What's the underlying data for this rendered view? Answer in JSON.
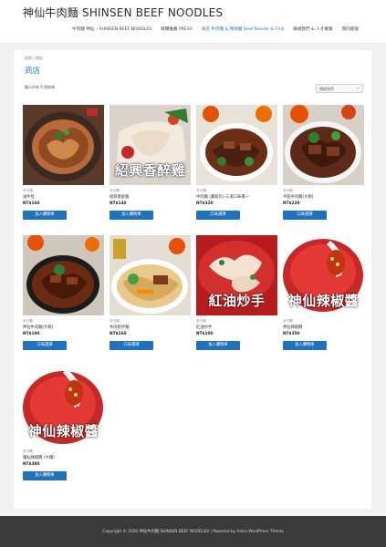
{
  "header": {
    "site_title": "神仙牛肉麵 SHINSEN BEEF NOODLES",
    "nav": [
      {
        "label": "牛肉麵 神仙 – SHINSEN BEEF NOODLES"
      },
      {
        "label": "媒體推薦 PRESS"
      },
      {
        "label": "商店 牛肉麵 & 辣椒醬 Beef Noodle & Chili"
      },
      {
        "label": "聯絡我們 & 人才募集"
      },
      {
        "label": "我的帳號"
      }
    ]
  },
  "shop": {
    "breadcrumb": "首頁 / 商店",
    "title": "商店",
    "result_count": "顯示所有 9 個結果",
    "orderby": "預設排序"
  },
  "products": [
    {
      "category": "未分類",
      "name": "滷牛肚",
      "price": "NT$160",
      "button": "加入購物車",
      "overlay": ""
    },
    {
      "category": "未分類",
      "name": "紹興香醉雞",
      "price": "NT$140",
      "button": "加入購物車",
      "overlay": "紹興香醉雞"
    },
    {
      "category": "未分類",
      "name": "牛肉麵 (量販包)-三道口味擇一",
      "price": "NT$320",
      "button": "口味選擇",
      "overlay": ""
    },
    {
      "category": "未分類",
      "name": "半筋半肉麵(大碗)",
      "price": "NT$220",
      "button": "口味選擇",
      "overlay": ""
    },
    {
      "category": "未分類",
      "name": "神仙牛肉麵(大碗)",
      "price": "NT$190",
      "button": "口味選擇",
      "overlay": ""
    },
    {
      "category": "未分類",
      "name": "牛肉乾拌麵",
      "price": "NT$160",
      "button": "口味選擇",
      "overlay": ""
    },
    {
      "category": "未分類",
      "name": "紅油抄手",
      "price": "NT$100",
      "button": "加入購物車",
      "overlay": "紅油炒手"
    },
    {
      "category": "未分類",
      "name": "神仙辣椒醬",
      "price": "NT$350",
      "button": "加入購物車",
      "overlay": "神仙辣椒醬"
    },
    {
      "category": "未分類",
      "name": "彌仙辣椒醬 (大罐)",
      "price": "NT$380",
      "button": "加入購物車",
      "overlay": "神仙辣椒醬"
    }
  ],
  "footer": {
    "text": "Copyright © 2020 神仙牛肉麵 SHINSEN BEEF NOODLES | Powered by Astra WordPress Theme"
  },
  "colors": {
    "accent": "#2a7bd0",
    "button": "#1f72bf",
    "footer_bg": "#3a3a3a"
  }
}
